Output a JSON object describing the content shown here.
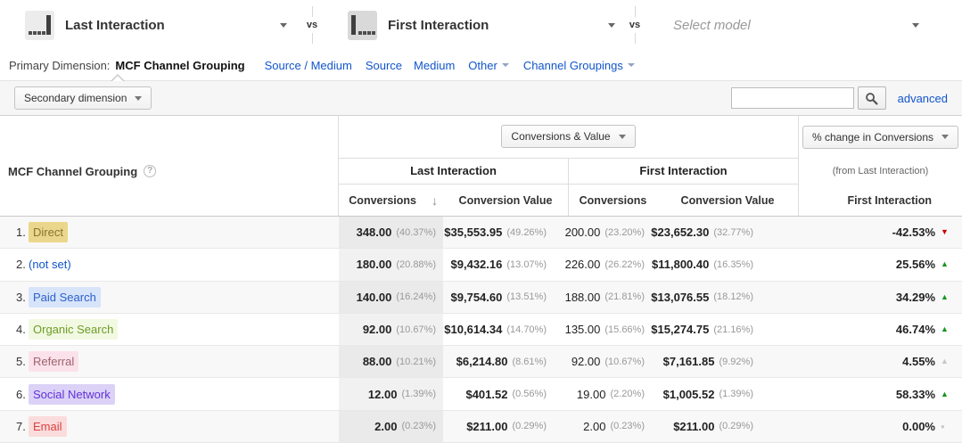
{
  "model_comparison": {
    "model1": {
      "label": "Last Interaction"
    },
    "vs1": "vs",
    "model2": {
      "label": "First Interaction"
    },
    "vs2": "vs",
    "model3": {
      "placeholder": "Select model"
    }
  },
  "primary_dimension": {
    "label": "Primary Dimension:",
    "selected": "MCF Channel Grouping",
    "links": {
      "source_medium": "Source / Medium",
      "source": "Source",
      "medium": "Medium",
      "other": "Other",
      "channel_groupings": "Channel Groupings"
    }
  },
  "toolbar": {
    "secondary_dimension": "Secondary dimension",
    "search_value": "",
    "advanced": "advanced"
  },
  "table": {
    "dimension_header": "MCF Channel Grouping",
    "metric_selector": "Conversions & Value",
    "change_selector": "% change in Conversions",
    "change_note": "(from Last Interaction)",
    "group_last": "Last Interaction",
    "group_first": "First Interaction",
    "col_conversions": "Conversions",
    "col_conversion_value": "Conversion Value",
    "col_change": "First Interaction",
    "rows": [
      {
        "num": "1.",
        "chan": "direct",
        "channel": "Direct",
        "li_conv": "348.00",
        "li_conv_pct": "(40.37%)",
        "li_val": "$35,553.95",
        "li_val_pct": "(49.26%)",
        "fi_conv": "200.00",
        "fi_conv_pct": "(23.20%)",
        "fi_val": "$23,652.30",
        "fi_val_pct": "(32.77%)",
        "change": "-42.53%",
        "trend": "down-red"
      },
      {
        "num": "2.",
        "chan": "notset",
        "channel": "(not set)",
        "li_conv": "180.00",
        "li_conv_pct": "(20.88%)",
        "li_val": "$9,432.16",
        "li_val_pct": "(13.07%)",
        "fi_conv": "226.00",
        "fi_conv_pct": "(26.22%)",
        "fi_val": "$11,800.40",
        "fi_val_pct": "(16.35%)",
        "change": "25.56%",
        "trend": "up-green"
      },
      {
        "num": "3.",
        "chan": "paid",
        "channel": "Paid Search",
        "li_conv": "140.00",
        "li_conv_pct": "(16.24%)",
        "li_val": "$9,754.60",
        "li_val_pct": "(13.51%)",
        "fi_conv": "188.00",
        "fi_conv_pct": "(21.81%)",
        "fi_val": "$13,076.55",
        "fi_val_pct": "(18.12%)",
        "change": "34.29%",
        "trend": "up-green"
      },
      {
        "num": "4.",
        "chan": "organic",
        "channel": "Organic Search",
        "li_conv": "92.00",
        "li_conv_pct": "(10.67%)",
        "li_val": "$10,614.34",
        "li_val_pct": "(14.70%)",
        "fi_conv": "135.00",
        "fi_conv_pct": "(15.66%)",
        "fi_val": "$15,274.75",
        "fi_val_pct": "(21.16%)",
        "change": "46.74%",
        "trend": "up-green"
      },
      {
        "num": "5.",
        "chan": "referral",
        "channel": "Referral",
        "li_conv": "88.00",
        "li_conv_pct": "(10.21%)",
        "li_val": "$6,214.80",
        "li_val_pct": "(8.61%)",
        "fi_conv": "92.00",
        "fi_conv_pct": "(10.67%)",
        "fi_val": "$7,161.85",
        "fi_val_pct": "(9.92%)",
        "change": "4.55%",
        "trend": "up-gray"
      },
      {
        "num": "6.",
        "chan": "social",
        "channel": "Social Network",
        "li_conv": "12.00",
        "li_conv_pct": "(1.39%)",
        "li_val": "$401.52",
        "li_val_pct": "(0.56%)",
        "fi_conv": "19.00",
        "fi_conv_pct": "(2.20%)",
        "fi_val": "$1,005.52",
        "fi_val_pct": "(1.39%)",
        "change": "58.33%",
        "trend": "up-green"
      },
      {
        "num": "7.",
        "chan": "email",
        "channel": "Email",
        "li_conv": "2.00",
        "li_conv_pct": "(0.23%)",
        "li_val": "$211.00",
        "li_val_pct": "(0.29%)",
        "fi_conv": "2.00",
        "fi_conv_pct": "(0.23%)",
        "fi_val": "$211.00",
        "fi_val_pct": "(0.29%)",
        "change": "0.00%",
        "trend": "dot-gray"
      }
    ]
  },
  "colors": {
    "link_blue": "#1155cc",
    "positive_green": "#149618",
    "negative_red": "#cc0000",
    "neutral_gray": "#c6c6c6",
    "sorted_column_bg": "#efefef",
    "row_stripe_bg": "#f8f8f8",
    "channel_chips": {
      "direct": {
        "bg": "#EAD78B",
        "text": "#8A7430"
      },
      "notset": {
        "bg": "",
        "text": "#1155cc"
      },
      "paid": {
        "bg": "#D7E4FA",
        "text": "#2E61C9"
      },
      "organic": {
        "bg": "#F2F9E2",
        "text": "#6D9C28"
      },
      "referral": {
        "bg": "#FBE2EA",
        "text": "#9E6270"
      },
      "social": {
        "bg": "#DCD2F7",
        "text": "#6133D8"
      },
      "email": {
        "bg": "#FBDCDC",
        "text": "#DD4040"
      }
    }
  }
}
